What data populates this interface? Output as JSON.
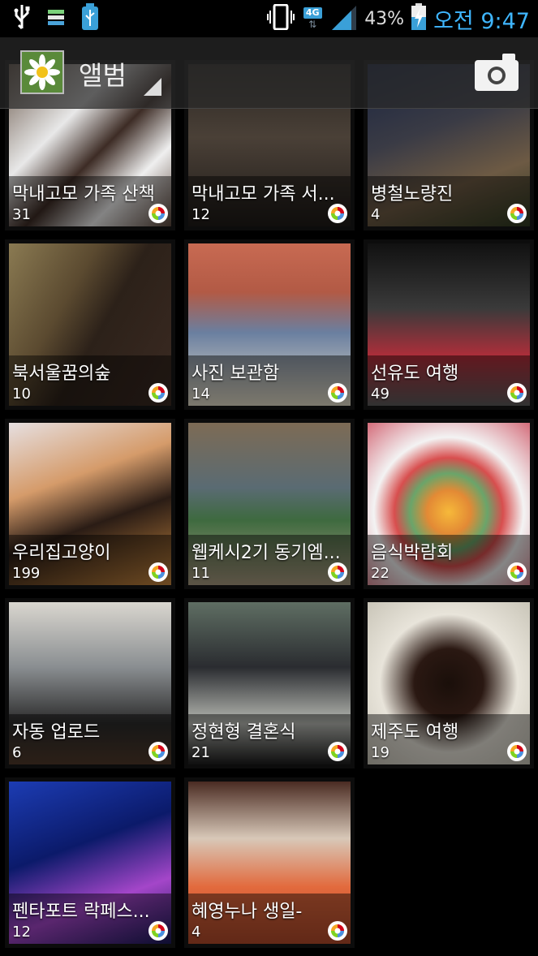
{
  "status_bar": {
    "network_tag": "4G",
    "battery_percent": "43%",
    "time": "오전 9:47",
    "icons": [
      "usb-icon",
      "storage-icon",
      "usb-debug-icon",
      "vibrate-icon",
      "signal-icon",
      "battery-charging-icon"
    ]
  },
  "action_bar": {
    "title": "앨범",
    "app_icon": "gallery-daisy-icon",
    "camera_icon": "camera-icon"
  },
  "albums": [
    {
      "name": "막내고모 가족 산책",
      "count": "31"
    },
    {
      "name": "막내고모 가족 서...",
      "count": "12"
    },
    {
      "name": "병철노량진",
      "count": "4"
    },
    {
      "name": "북서울꿈의숲",
      "count": "10"
    },
    {
      "name": "사진 보관함",
      "count": "14"
    },
    {
      "name": "선유도 여행",
      "count": "49"
    },
    {
      "name": "우리집고양이",
      "count": "199"
    },
    {
      "name": "웹케시2기 동기엠...",
      "count": "11"
    },
    {
      "name": "음식박람회",
      "count": "22"
    },
    {
      "name": "자동 업로드",
      "count": "6"
    },
    {
      "name": "정현형 결혼식",
      "count": "21"
    },
    {
      "name": "제주도 여행",
      "count": "19"
    },
    {
      "name": "펜타포트 락페스...",
      "count": "12"
    },
    {
      "name": "혜영누나 생일-",
      "count": "4"
    }
  ]
}
